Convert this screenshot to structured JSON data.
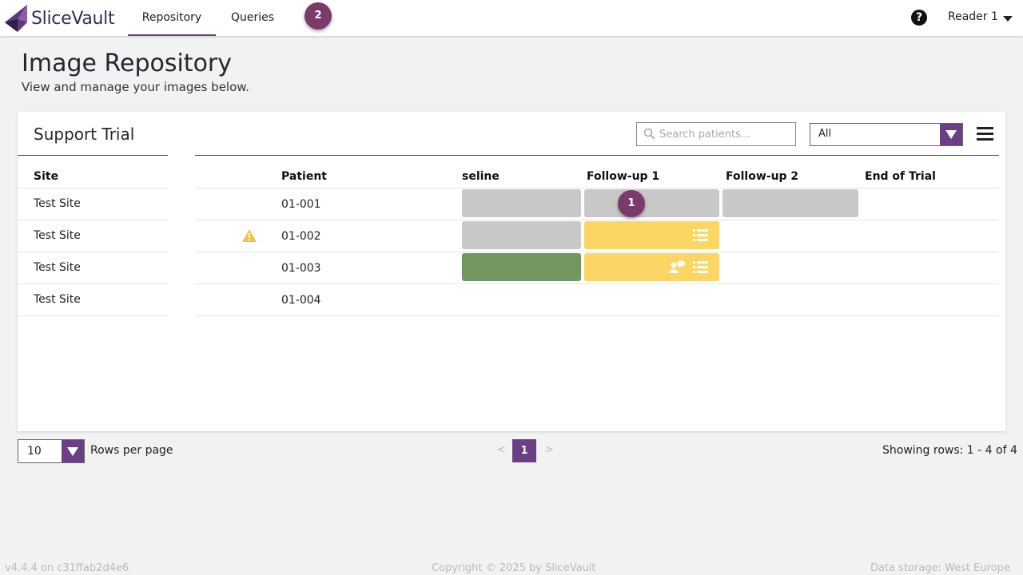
{
  "app": {
    "name": "SliceVault"
  },
  "nav": {
    "tabs": [
      {
        "label": "Repository",
        "active": true
      },
      {
        "label": "Queries",
        "active": false
      }
    ],
    "step_badge": "2",
    "help_icon": "question-circle-icon",
    "user": "Reader 1"
  },
  "page": {
    "title": "Image Repository",
    "subtitle": "View and manage your images below."
  },
  "card": {
    "trial_name": "Support Trial",
    "search_placeholder": "Search patients...",
    "filter_value": "All"
  },
  "table": {
    "site_header": "Site",
    "patient_header": "Patient",
    "visit_headers": [
      "seline",
      "Follow-up 1",
      "Follow-up 2",
      "End of Trial"
    ],
    "rows": [
      {
        "site": "Test Site",
        "patient": "01-001",
        "warning": false,
        "visits": [
          "grey",
          "grey",
          "grey",
          "none"
        ]
      },
      {
        "site": "Test Site",
        "patient": "01-002",
        "warning": true,
        "visits": [
          "grey",
          "yellow",
          "none",
          "none"
        ]
      },
      {
        "site": "Test Site",
        "patient": "01-003",
        "warning": false,
        "visits": [
          "green",
          "yellow",
          "none",
          "none"
        ]
      },
      {
        "site": "Test Site",
        "patient": "01-004",
        "warning": false,
        "visits": [
          "none",
          "none",
          "none",
          "none"
        ]
      }
    ],
    "cell_badge": "1"
  },
  "colors": {
    "accent": "#6b3f86",
    "badge": "#7a3b6b",
    "grey": "#c8c8c8",
    "yellow": "#fbd664",
    "green": "#739560",
    "warning": "#f0c24a"
  },
  "pagination": {
    "rows_per_page": "10",
    "rows_label": "Rows per page",
    "prev": "<",
    "next": ">",
    "current_page": "1",
    "showing": "Showing rows: 1 - 4 of 4"
  },
  "footer": {
    "version": "v4.4.4 on c31ffab2d4e6",
    "copyright": "Copyright © 2025 by SliceVault",
    "storage": "Data storage: West Europe"
  }
}
